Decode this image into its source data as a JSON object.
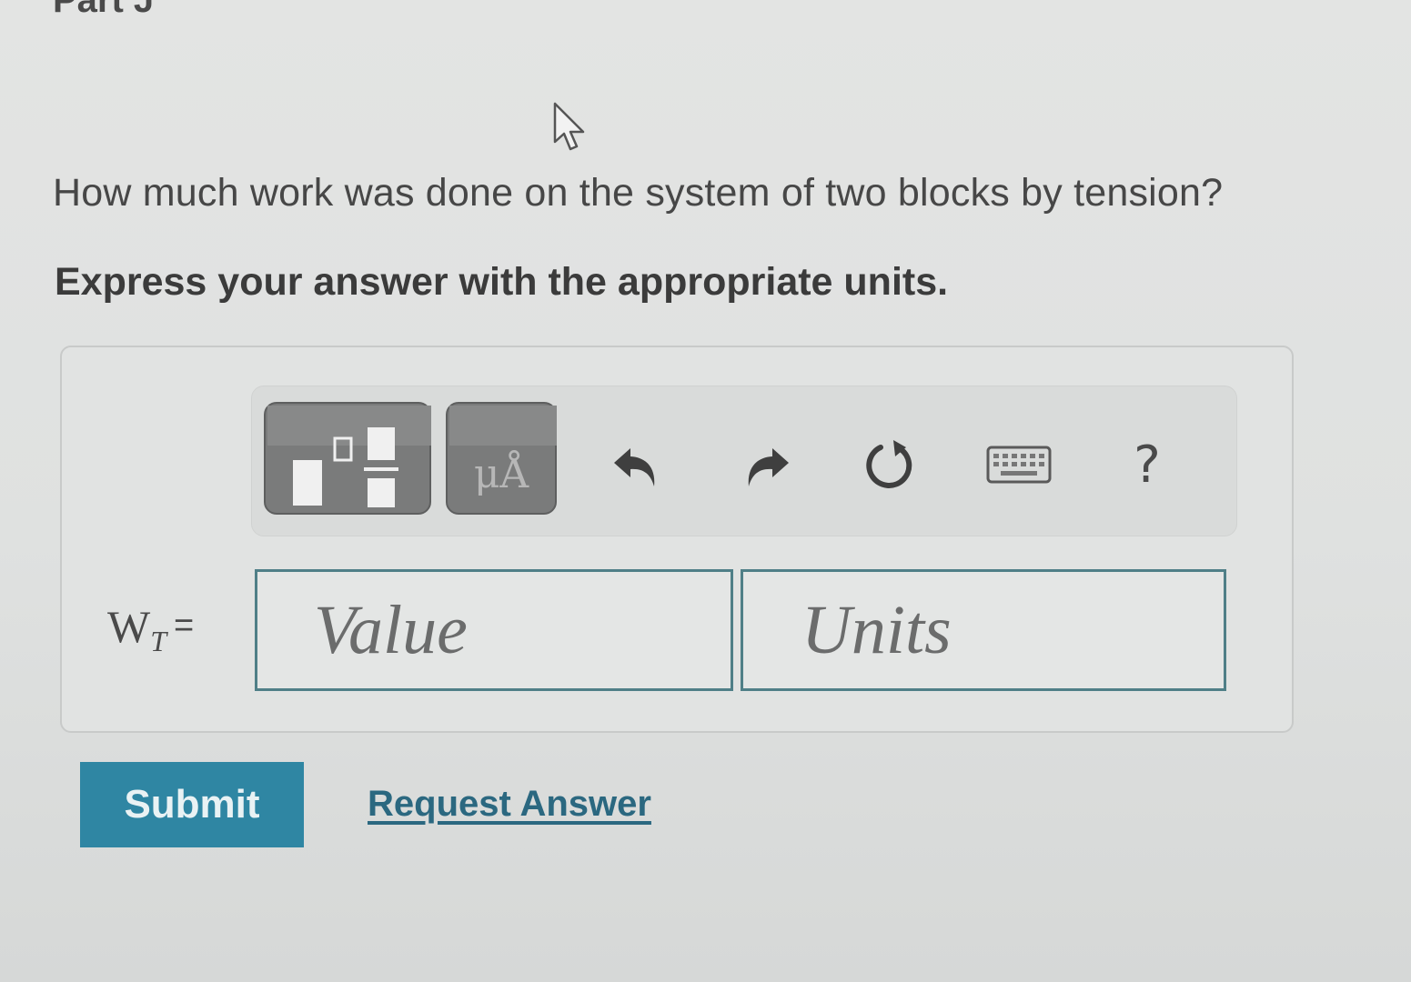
{
  "part": {
    "title": "Part J"
  },
  "question": {
    "text": "How much work was done on the system of two blocks by tension?",
    "instruction": "Express your answer with the appropriate units."
  },
  "toolbar": {
    "units_glyph": "μÅ",
    "help_label": "?",
    "icons": [
      "templates-icon",
      "units-icon",
      "undo-icon",
      "redo-icon",
      "reset-icon",
      "keyboard-icon",
      "help-icon"
    ]
  },
  "answer": {
    "variable": "W",
    "subscript": "T",
    "equals": "=",
    "value_placeholder": "Value",
    "units_placeholder": "Units"
  },
  "actions": {
    "submit_label": "Submit",
    "request_label": "Request Answer"
  },
  "colors": {
    "accent": "#2f86a3",
    "link": "#2b6880",
    "field_border": "#4f7f87"
  }
}
